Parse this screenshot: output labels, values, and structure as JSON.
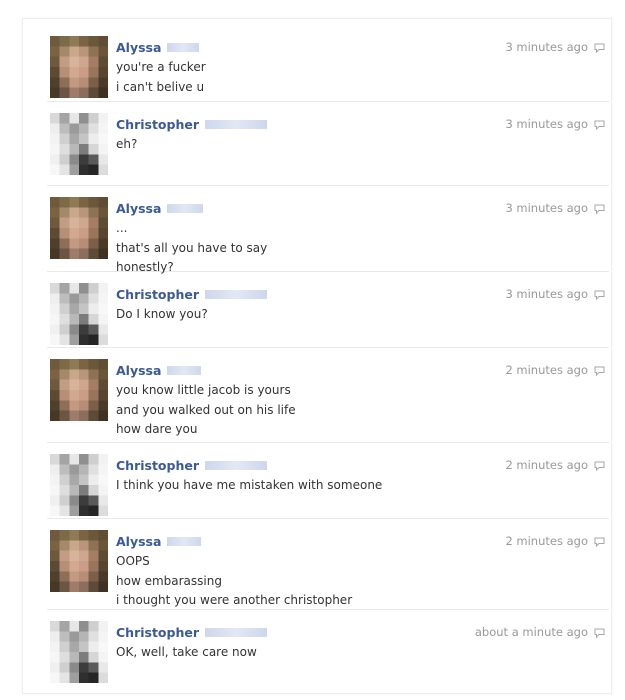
{
  "messages": [
    {
      "sender": "Alyssa",
      "time": "3 minutes ago",
      "lines": [
        "you're a fucker",
        "i can't belive u"
      ]
    },
    {
      "sender": "Christopher",
      "time": "3 minutes ago",
      "lines": [
        "eh?"
      ]
    },
    {
      "sender": "Alyssa",
      "time": "3 minutes ago",
      "lines": [
        "...",
        "that's all you have to say",
        "honestly?"
      ]
    },
    {
      "sender": "Christopher",
      "time": "3 minutes ago",
      "lines": [
        "Do I know you?"
      ]
    },
    {
      "sender": "Alyssa",
      "time": "2 minutes ago",
      "lines": [
        "you know little jacob is yours",
        "and you walked out on his life",
        "how dare you"
      ]
    },
    {
      "sender": "Christopher",
      "time": "2 minutes ago",
      "lines": [
        "I think you have me mistaken with someone"
      ]
    },
    {
      "sender": "Alyssa",
      "time": "2 minutes ago",
      "lines": [
        "OOPS",
        "how embarassing",
        "i thought you were another christopher"
      ]
    },
    {
      "sender": "Christopher",
      "time": "about a minute ago",
      "lines": [
        "OK, well, take care now"
      ]
    }
  ],
  "icons": {
    "avatar": "pixelated-avatar",
    "reply": "speech-bubble-icon"
  },
  "colors": {
    "name": "#3b5998",
    "text": "#333333",
    "timestamp": "#999999",
    "divider": "#e9e9e9"
  }
}
